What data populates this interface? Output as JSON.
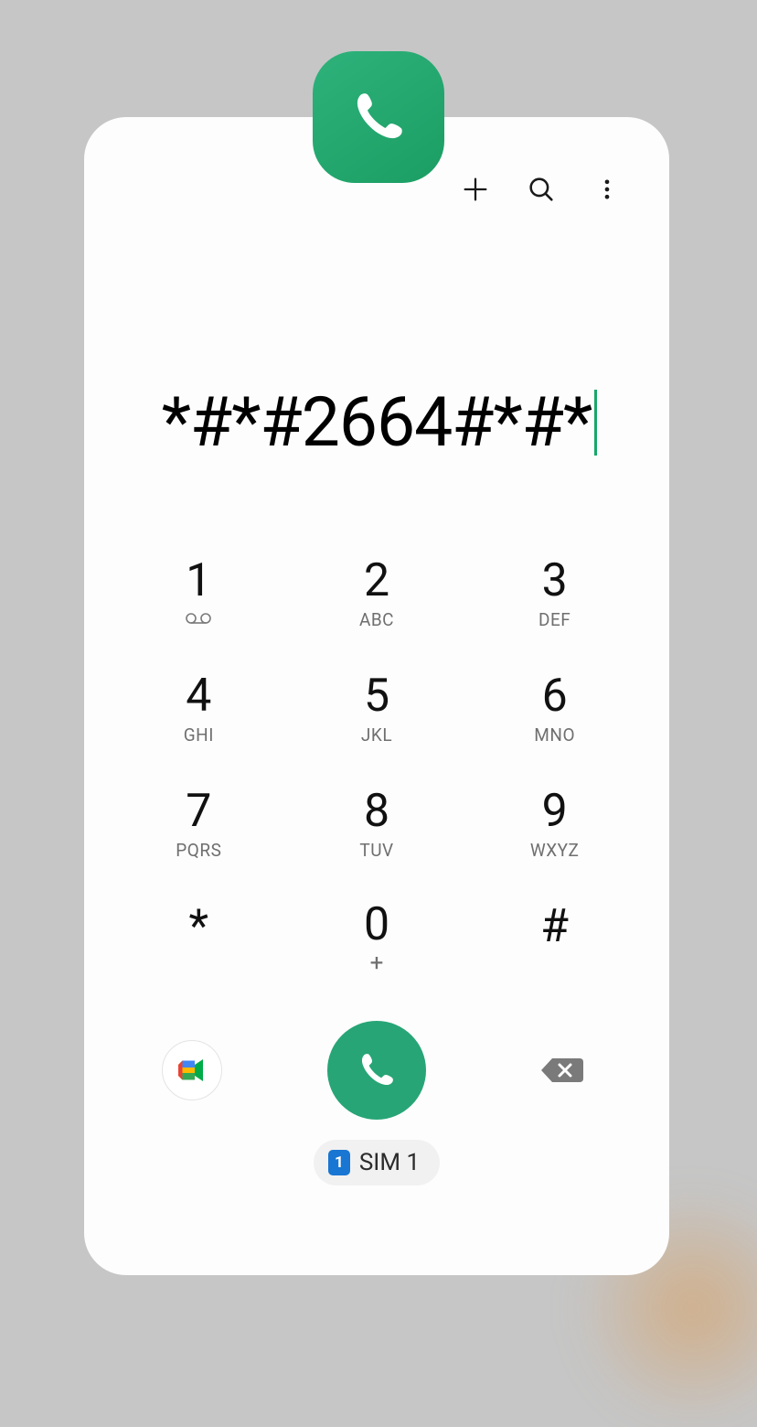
{
  "header": {
    "icons": {
      "add": "add-icon",
      "search": "search-icon",
      "more": "more-vert-icon"
    }
  },
  "display": {
    "number": "*#*#2664#*#*"
  },
  "keypad": {
    "keys": [
      {
        "digit": "1",
        "label": ""
      },
      {
        "digit": "2",
        "label": "ABC"
      },
      {
        "digit": "3",
        "label": "DEF"
      },
      {
        "digit": "4",
        "label": "GHI"
      },
      {
        "digit": "5",
        "label": "JKL"
      },
      {
        "digit": "6",
        "label": "MNO"
      },
      {
        "digit": "7",
        "label": "PQRS"
      },
      {
        "digit": "8",
        "label": "TUV"
      },
      {
        "digit": "9",
        "label": "WXYZ"
      },
      {
        "digit": "*",
        "label": ""
      },
      {
        "digit": "0",
        "label": "+"
      },
      {
        "digit": "#",
        "label": ""
      }
    ]
  },
  "sim": {
    "badge": "1",
    "label": "SIM 1"
  },
  "colors": {
    "accent": "#27a576",
    "background": "#c6c6c6",
    "card": "#fdfdfd",
    "sim_blue": "#1976d2"
  }
}
